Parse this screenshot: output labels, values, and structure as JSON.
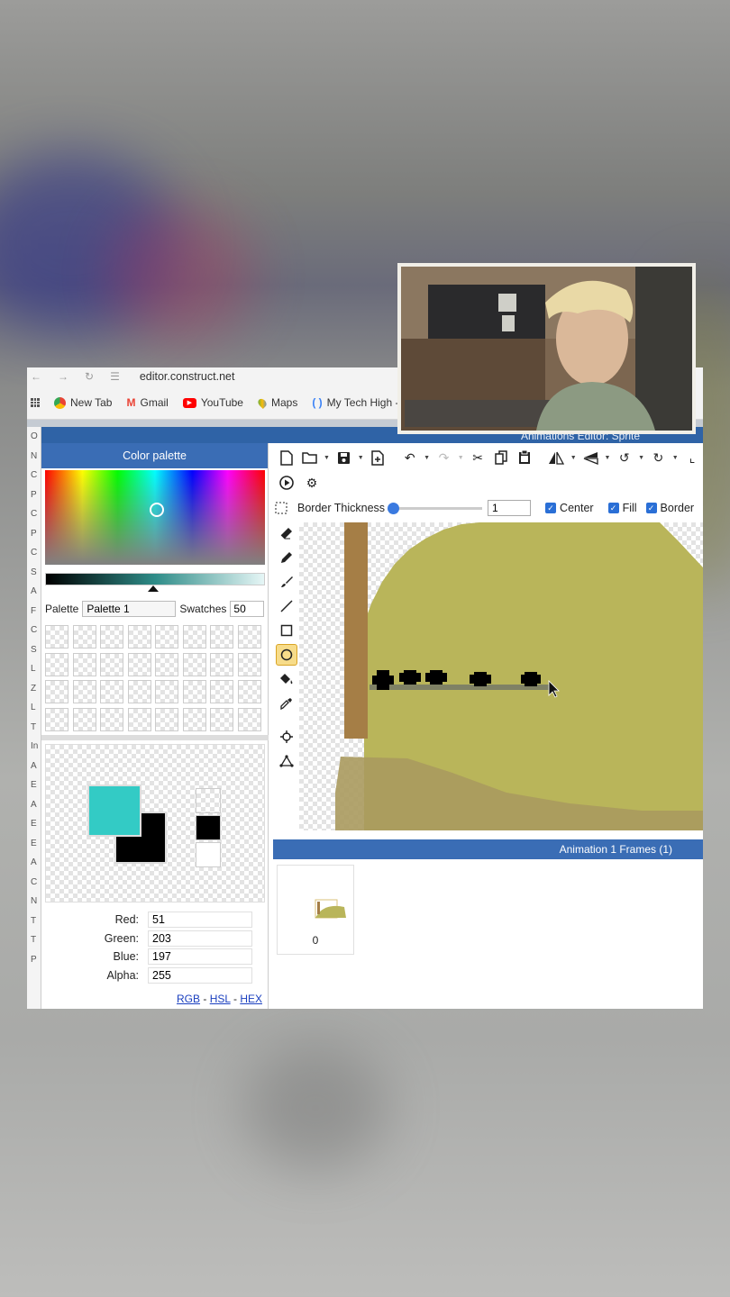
{
  "browser": {
    "url": "editor.construct.net",
    "bookmarks": [
      {
        "label": "New Tab",
        "icon": "chrome-icon",
        "color": "#4285f4"
      },
      {
        "label": "Gmail",
        "icon": "gmail-icon",
        "color": "#ea4335"
      },
      {
        "label": "YouTube",
        "icon": "youtube-icon",
        "color": "#ff0000"
      },
      {
        "label": "Maps",
        "icon": "maps-icon",
        "color": "#34a853"
      },
      {
        "label": "My Tech High -",
        "icon": "mytechhigh-icon",
        "color": "#3b82f6"
      }
    ]
  },
  "editor": {
    "title": "Animations Editor: Sprite"
  },
  "left_strip": [
    "O",
    "N",
    "C",
    "P",
    "C",
    "P",
    "C",
    "S",
    "A",
    "F",
    "C",
    "S",
    "L",
    "Z",
    "L",
    "T",
    "In",
    "A",
    "E",
    "A",
    "E",
    "E",
    "A",
    "C",
    "N",
    "T",
    "T",
    "P"
  ],
  "palette": {
    "header": "Color palette",
    "palette_label": "Palette",
    "palette_value": "Palette 1",
    "swatches_label": "Swatches",
    "swatches_value": "50",
    "swatch_count_visible": 32,
    "fg_color": "#33cbc5",
    "bg_color": "#000000",
    "channels": [
      {
        "label": "Red:",
        "value": "51"
      },
      {
        "label": "Green:",
        "value": "203"
      },
      {
        "label": "Blue:",
        "value": "197"
      },
      {
        "label": "Alpha:",
        "value": "255"
      }
    ],
    "modes": [
      "RGB",
      "HSL",
      "HEX"
    ],
    "mode_sep": "-"
  },
  "options": {
    "border_thickness_label": "Border Thickness",
    "border_thickness_value": "1",
    "center_label": "Center",
    "fill_label": "Fill",
    "border_label": "Border"
  },
  "colors": {
    "accent": "#3a6db5",
    "canvas_fill": "#b9b55a",
    "post": "#a57e46",
    "ground": "#aa9a5e"
  },
  "frames": {
    "header": "Animation 1 Frames (1)",
    "items": [
      {
        "label": "0"
      }
    ]
  }
}
